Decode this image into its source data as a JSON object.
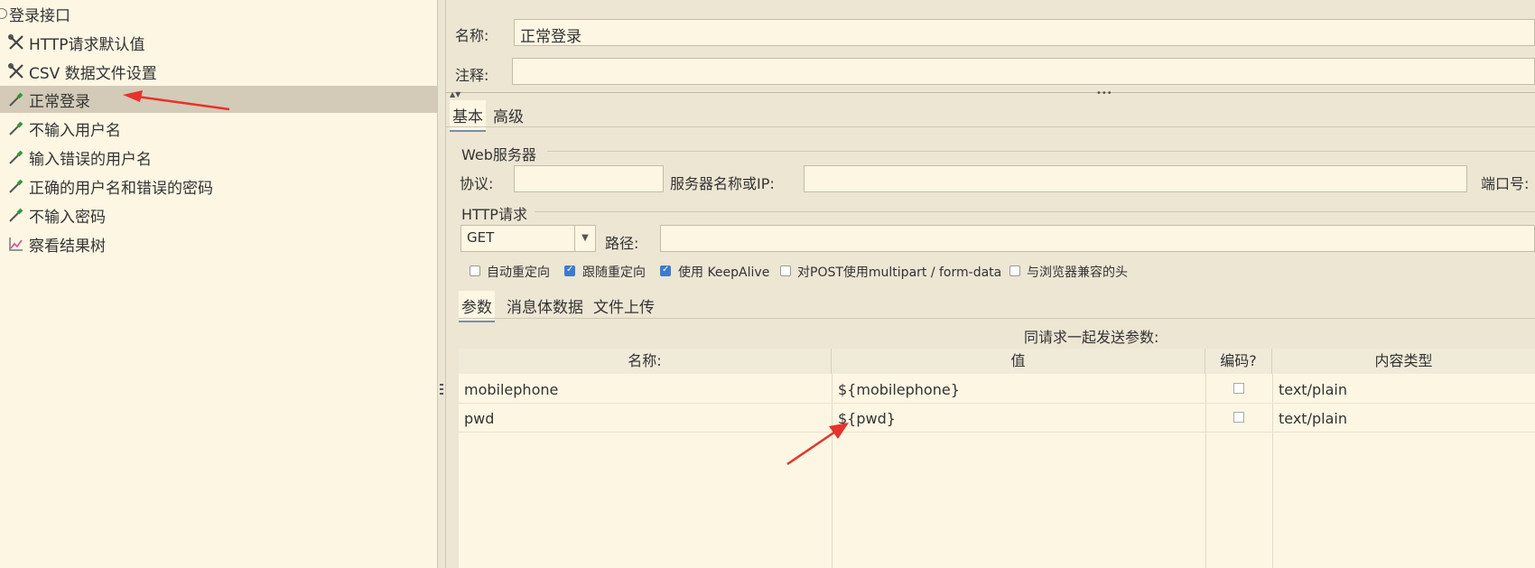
{
  "tree": {
    "root_label": "登录接口",
    "items": [
      {
        "label": "HTTP请求默认值",
        "icon": "wrench-icon"
      },
      {
        "label": "CSV 数据文件设置",
        "icon": "wrench-icon"
      },
      {
        "label": "正常登录",
        "icon": "pipette-icon"
      },
      {
        "label": "不输入用户名",
        "icon": "pipette-icon"
      },
      {
        "label": "输入错误的用户名",
        "icon": "pipette-icon"
      },
      {
        "label": "正确的用户名和错误的密码",
        "icon": "pipette-icon"
      },
      {
        "label": "不输入密码",
        "icon": "pipette-icon"
      },
      {
        "label": "察看结果树",
        "icon": "chart-icon"
      }
    ]
  },
  "form": {
    "name_label": "名称:",
    "name_value": "正常登录",
    "comment_label": "注释:",
    "comment_value": ""
  },
  "tabs": {
    "basic": "基本",
    "advanced": "高级"
  },
  "web_server": {
    "legend": "Web服务器",
    "protocol_label": "协议:",
    "protocol_value": "",
    "server_label": "服务器名称或IP:",
    "server_value": "",
    "port_label": "端口号:"
  },
  "http_request": {
    "legend": "HTTP请求",
    "method": "GET",
    "path_label": "路径:",
    "path_value": ""
  },
  "options": [
    {
      "label": "自动重定向",
      "checked": false
    },
    {
      "label": "跟随重定向",
      "checked": true
    },
    {
      "label": "使用 KeepAlive",
      "checked": true
    },
    {
      "label": "对POST使用multipart / form-data",
      "checked": false
    },
    {
      "label": "与浏览器兼容的头",
      "checked": false
    }
  ],
  "sub_tabs": {
    "params": "参数",
    "body": "消息体数据",
    "files": "文件上传"
  },
  "params": {
    "caption": "同请求一起发送参数:",
    "headers": [
      "名称:",
      "值",
      "编码?",
      "内容类型"
    ],
    "rows": [
      {
        "name": "mobilephone",
        "value": "${mobilephone}",
        "encode": false,
        "content_type": "text/plain"
      },
      {
        "name": "pwd",
        "value": "${pwd}",
        "encode": false,
        "content_type": "text/plain"
      }
    ]
  },
  "colors": {
    "annotation_arrow": "#e8322a",
    "checkbox_checked": "#3a7bd5",
    "selected_row": "#d3cbb7"
  }
}
